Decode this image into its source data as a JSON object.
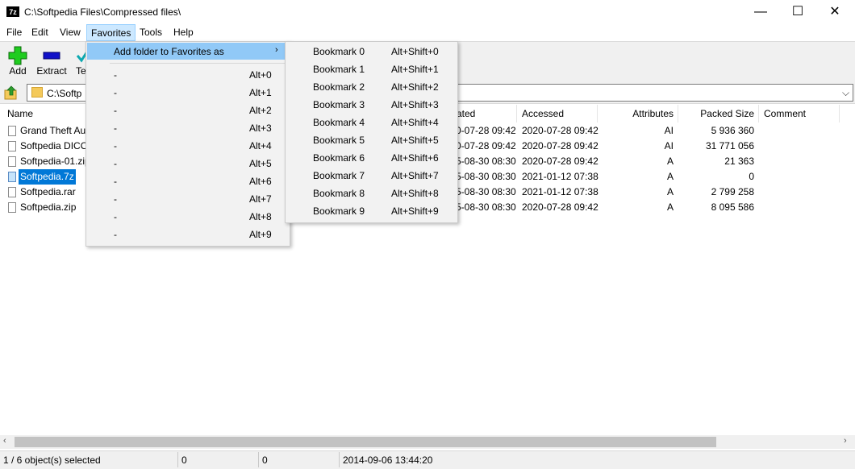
{
  "window": {
    "title": "C:\\Softpedia Files\\Compressed files\\",
    "app_icon_text": "7z",
    "controls": {
      "minimize": "—",
      "maximize": "☐",
      "close": "✕"
    }
  },
  "menubar": [
    "File",
    "Edit",
    "View",
    "Favorites",
    "Tools",
    "Help"
  ],
  "toolbar": {
    "add": "Add",
    "extract": "Extract",
    "test": "Te"
  },
  "address": {
    "path": "C:\\Softp"
  },
  "columns": {
    "name": "Name",
    "created": "ated",
    "accessed": "Accessed",
    "attributes": "Attributes",
    "packed_size": "Packed Size",
    "comment": "Comment"
  },
  "files": [
    {
      "name": "Grand Theft Au",
      "created": "0-07-28 09:42",
      "accessed": "2020-07-28 09:42",
      "attributes": "AI",
      "packed": "5 936 360",
      "selected": false
    },
    {
      "name": "Softpedia DICO",
      "created": "0-07-28 09:42",
      "accessed": "2020-07-28 09:42",
      "attributes": "AI",
      "packed": "31 771 056",
      "selected": false
    },
    {
      "name": "Softpedia-01.zip",
      "created": "5-08-30 08:30",
      "accessed": "2020-07-28 09:42",
      "attributes": "A",
      "packed": "21 363",
      "selected": false
    },
    {
      "name": "Softpedia.7z",
      "created": "5-08-30 08:30",
      "accessed": "2021-01-12 07:38",
      "attributes": "A",
      "packed": "0",
      "selected": true
    },
    {
      "name": "Softpedia.rar",
      "created": "5-08-30 08:30",
      "accessed": "2021-01-12 07:38",
      "attributes": "A",
      "packed": "2 799 258",
      "selected": false
    },
    {
      "name": "Softpedia.zip",
      "created": "5-08-30 08:30",
      "accessed": "2020-07-28 09:42",
      "attributes": "A",
      "packed": "8 095 586",
      "selected": false
    }
  ],
  "favorites_menu": {
    "add_folder": "Add folder to Favorites as",
    "items": [
      {
        "label": "-",
        "shortcut": "Alt+0"
      },
      {
        "label": "-",
        "shortcut": "Alt+1"
      },
      {
        "label": "-",
        "shortcut": "Alt+2"
      },
      {
        "label": "-",
        "shortcut": "Alt+3"
      },
      {
        "label": "-",
        "shortcut": "Alt+4"
      },
      {
        "label": "-",
        "shortcut": "Alt+5"
      },
      {
        "label": "-",
        "shortcut": "Alt+6"
      },
      {
        "label": "-",
        "shortcut": "Alt+7"
      },
      {
        "label": "-",
        "shortcut": "Alt+8"
      },
      {
        "label": "-",
        "shortcut": "Alt+9"
      }
    ]
  },
  "bookmarks_submenu": [
    {
      "label": "Bookmark 0",
      "shortcut": "Alt+Shift+0"
    },
    {
      "label": "Bookmark 1",
      "shortcut": "Alt+Shift+1"
    },
    {
      "label": "Bookmark 2",
      "shortcut": "Alt+Shift+2"
    },
    {
      "label": "Bookmark 3",
      "shortcut": "Alt+Shift+3"
    },
    {
      "label": "Bookmark 4",
      "shortcut": "Alt+Shift+4"
    },
    {
      "label": "Bookmark 5",
      "shortcut": "Alt+Shift+5"
    },
    {
      "label": "Bookmark 6",
      "shortcut": "Alt+Shift+6"
    },
    {
      "label": "Bookmark 7",
      "shortcut": "Alt+Shift+7"
    },
    {
      "label": "Bookmark 8",
      "shortcut": "Alt+Shift+8"
    },
    {
      "label": "Bookmark 9",
      "shortcut": "Alt+Shift+9"
    }
  ],
  "status": {
    "selection": "1 / 6 object(s) selected",
    "size": "0",
    "packed": "0",
    "modified": "2014-09-06 13:44:20"
  },
  "colors": {
    "selection": "#0078d7",
    "menu_highlight": "#91c9f7",
    "add_icon": "#1fcc1f",
    "extract_icon": "#1010c8"
  }
}
